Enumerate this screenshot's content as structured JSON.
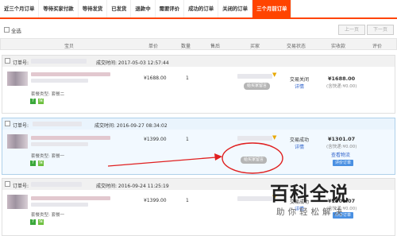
{
  "tabs": [
    {
      "label": "近三个月订单",
      "active": false
    },
    {
      "label": "等待买家付款",
      "active": false
    },
    {
      "label": "等待发货",
      "active": false
    },
    {
      "label": "已发货",
      "active": false
    },
    {
      "label": "退款中",
      "active": false
    },
    {
      "label": "需要评价",
      "active": false
    },
    {
      "label": "成功的订单",
      "active": false
    },
    {
      "label": "关闭的订单",
      "active": false
    },
    {
      "label": "三个月前订单",
      "active": true
    }
  ],
  "toolbar": {
    "select_all": "全选",
    "prev_page": "上一页",
    "next_page": "下一页"
  },
  "columns": {
    "item": "宝贝",
    "price": "单价",
    "qty": "数量",
    "after_sale": "售后",
    "buyer": "买家",
    "status": "交易状态",
    "paid": "实收款",
    "review": "评价"
  },
  "orders": [
    {
      "order_no_label": "订单号:",
      "deal_time": "成交时间: 2017-05-03 12:57:44",
      "package": "套餐类型: 套餐二",
      "price": "¥1688.00",
      "qty": "1",
      "status": "交易关闭",
      "detail": "详情",
      "amount": "¥1688.00",
      "shipping": "(含快递:¥0.00)",
      "msg_btn": "给买家留言"
    },
    {
      "order_no_label": "订单号:",
      "deal_time": "成交时间: 2016-09-27 08:34:02",
      "package": "套餐类型: 套餐一",
      "price": "¥1399.00",
      "qty": "1",
      "status": "交易成功",
      "detail": "详情",
      "amount": "¥1301.07",
      "shipping": "(含快递:¥0.00)",
      "logistics": "查看物流",
      "action_btn": "评价订单",
      "msg_btn": "给买家留言"
    },
    {
      "order_no_label": "订单号:",
      "deal_time": "成交时间: 2016-09-24 11:25:19",
      "package": "套餐类型: 套餐一",
      "price": "¥1399.00",
      "qty": "1",
      "status": "交易成功",
      "detail": "详情",
      "amount": "¥1301.07",
      "shipping": "(含快递:¥0.00)",
      "action_btn": "评价订单"
    }
  ],
  "watermark": {
    "title": "百科全说",
    "subtitle": "助你轻松解决"
  },
  "colors": {
    "accent": "#ff4400",
    "link": "#3366cc",
    "annotation": "#e02020"
  }
}
